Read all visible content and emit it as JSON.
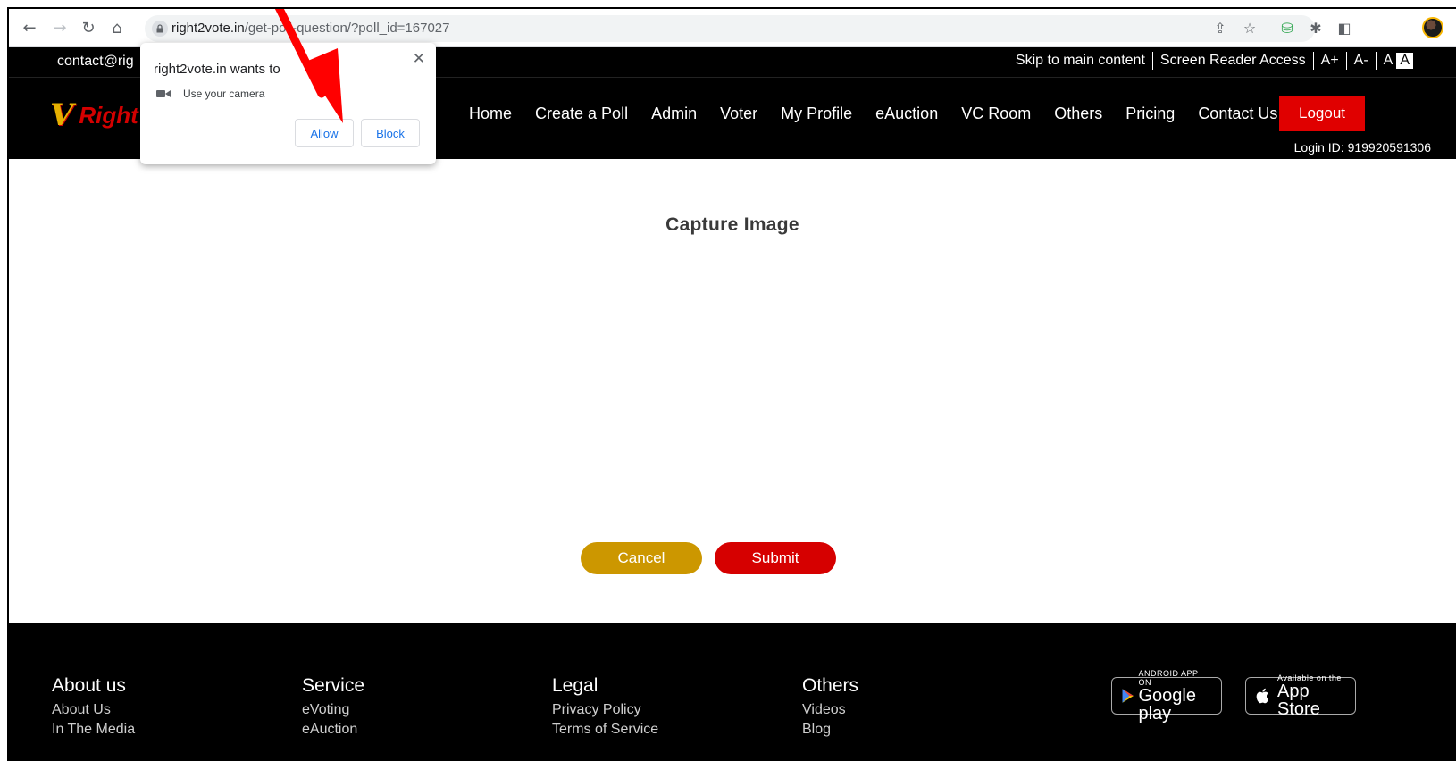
{
  "browser": {
    "url_host": "right2vote.in",
    "url_path": "/get-poll-question/?poll_id=167027"
  },
  "topbar": {
    "contact": "contact@rig",
    "skip": "Skip to main content",
    "screen_reader": "Screen Reader Access",
    "a_plus": "A+",
    "a_minus": "A-",
    "a_normal": "A",
    "a_contrast": "A"
  },
  "header": {
    "logo_mark": "V",
    "logo_text": "Right",
    "nav": [
      "Home",
      "Create a Poll",
      "Admin",
      "Voter",
      "My Profile",
      "eAuction",
      "VC Room",
      "Others",
      "Pricing",
      "Contact Us"
    ],
    "logout": "Logout",
    "login_id": "Login ID: 919920591306"
  },
  "main": {
    "title": "Capture Image",
    "cancel": "Cancel",
    "submit": "Submit"
  },
  "footer": {
    "about": {
      "heading": "About us",
      "links": [
        "About Us",
        "In The Media"
      ]
    },
    "service": {
      "heading": "Service",
      "links": [
        "eVoting",
        "eAuction"
      ]
    },
    "legal": {
      "heading": "Legal",
      "links": [
        "Privacy Policy",
        "Terms of Service"
      ]
    },
    "others": {
      "heading": "Others",
      "links": [
        "Videos",
        "Blog"
      ]
    },
    "google_small": "ANDROID APP ON",
    "google_big": "Google play",
    "apple_small": "Available on the",
    "apple_big": "App Store"
  },
  "popup": {
    "title": "right2vote.in wants to",
    "permission": "Use your camera",
    "allow": "Allow",
    "block": "Block",
    "close": "✕"
  },
  "colors": {
    "accent_red": "#e00000",
    "cancel_gold": "#cc9700",
    "link_blue": "#1a73e8"
  }
}
